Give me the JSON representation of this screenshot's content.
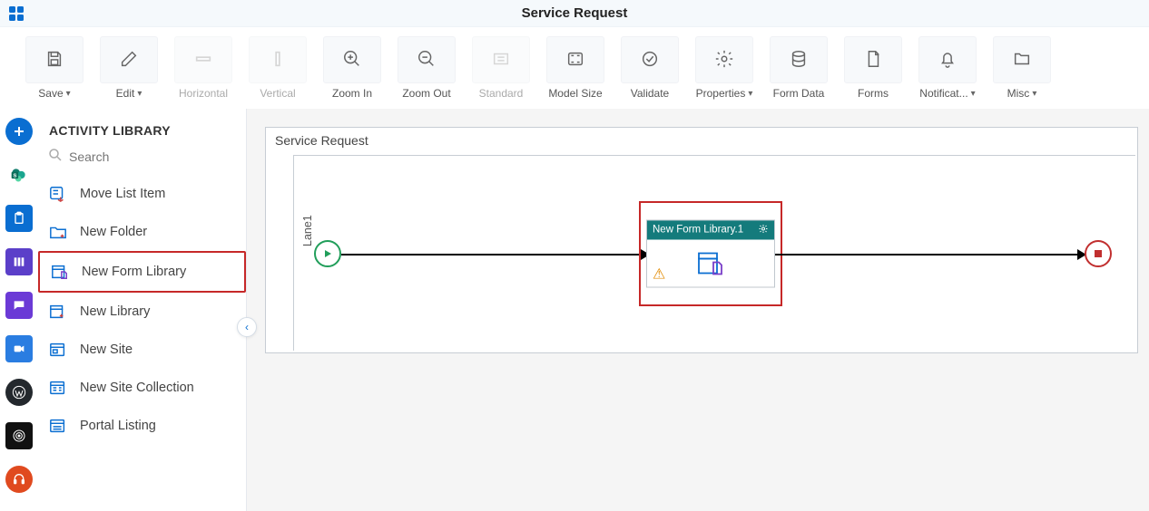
{
  "header": {
    "title": "Service Request"
  },
  "toolbar": {
    "save": "Save",
    "edit": "Edit",
    "horizontal": "Horizontal",
    "vertical": "Vertical",
    "zoomin": "Zoom In",
    "zoomout": "Zoom Out",
    "standard": "Standard",
    "modelsize": "Model Size",
    "validate": "Validate",
    "properties": "Properties",
    "formdata": "Form Data",
    "forms": "Forms",
    "notifications": "Notificat...",
    "misc": "Misc"
  },
  "panel": {
    "title": "ACTIVITY LIBRARY",
    "search_placeholder": "Search",
    "items": {
      "movelist": "Move List Item",
      "newfolder": "New Folder",
      "newformlib": "New Form Library",
      "newlibrary": "New Library",
      "newsite": "New Site",
      "newsitecol": "New Site Collection",
      "portal": "Portal Listing"
    }
  },
  "canvas": {
    "title": "Service Request",
    "lane": "Lane1",
    "activity_title": "New Form Library.1"
  }
}
